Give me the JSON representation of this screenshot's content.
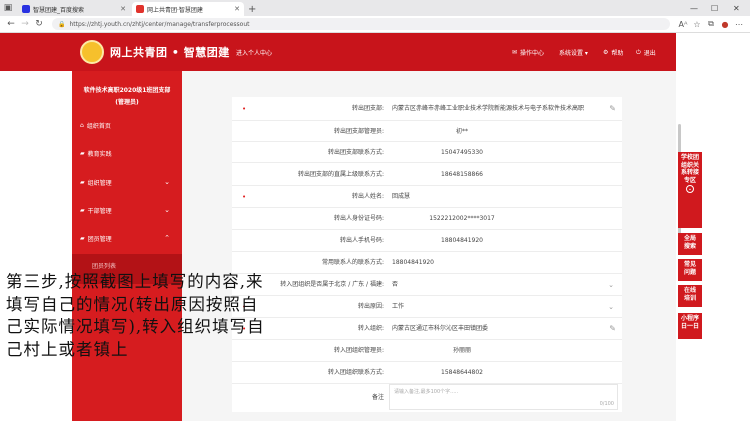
{
  "browser": {
    "tabs": [
      {
        "title": "智慧团建_百度搜索"
      },
      {
        "title": "网上共青团·智慧团建"
      }
    ],
    "address": "https://zhtj.youth.cn/zhtj/center/manage/transferprocessout"
  },
  "header": {
    "brand": "网上共青团 • 智慧团建",
    "personal": "进入个人中心",
    "nav": [
      {
        "icon": "envelope-icon",
        "label": "操作中心"
      },
      {
        "icon": "gear-icon",
        "label": "系统设置 ▾"
      },
      {
        "icon": "help-icon",
        "label": "帮助"
      },
      {
        "icon": "power-icon",
        "label": "退出"
      }
    ]
  },
  "sidebar": {
    "org_line1": "软件技术高职2020级1班团支部",
    "org_line2": "(管理员)",
    "menu": [
      {
        "icon": "home-icon",
        "label": "组织首页"
      },
      {
        "icon": "folder-icon",
        "label": "教育实践"
      },
      {
        "icon": "folder-icon",
        "label": "组织管理"
      },
      {
        "icon": "folder-icon",
        "label": "干部管理"
      },
      {
        "icon": "folder-icon",
        "label": "团员管理"
      }
    ],
    "sub": "团员列表"
  },
  "form": {
    "rows": [
      {
        "label": "转出团支部:",
        "value": "内蒙古区赤峰市赤峰工业职业技术学院新能源技术与电子系软件技术高职",
        "req": true
      },
      {
        "label": "转出团支部管理员:",
        "value": "初**"
      },
      {
        "label": "转出团支部联系方式:",
        "value": "15047495330"
      },
      {
        "label": "转出团支部的直属上级联系方式:",
        "value": "18648158866"
      },
      {
        "label": "转出人姓名:",
        "value": "回成慧",
        "req": true
      },
      {
        "label": "转出人身份证号码:",
        "value": "1522212002****3017"
      },
      {
        "label": "转出人手机号码:",
        "value": "18804841920"
      },
      {
        "label": "常用联系人的联系方式:",
        "value": "18804841920"
      },
      {
        "label": "转入团组织是否属于北京 / 广东 / 福建:",
        "value": "否"
      },
      {
        "label": "转出原因:",
        "value": "工作",
        "req": true
      },
      {
        "label": "转入组织:",
        "value": "内蒙古区通辽市科尔沁区丰田镇团委",
        "req": true
      },
      {
        "label": "转入团组织管理员:",
        "value": "孙丽丽"
      },
      {
        "label": "转入团组织联系方式:",
        "value": "15848644802"
      },
      {
        "label": "备注",
        "value": ""
      }
    ],
    "textarea_placeholder": "请输入备注,最多100个字.....",
    "counter": "0/100"
  },
  "right_bar": [
    {
      "label": "学校团组织关系转接专区"
    },
    {
      "label": "全局搜索"
    },
    {
      "label": "常见问题"
    },
    {
      "label": "在线培训"
    },
    {
      "label": "小程序日一日"
    }
  ],
  "overlay_text": "第三步,按照截图上填写的内容,来填写自己的情况(转出原因按照自己实际情况填写),转入组织填写自己村上或者镇上"
}
